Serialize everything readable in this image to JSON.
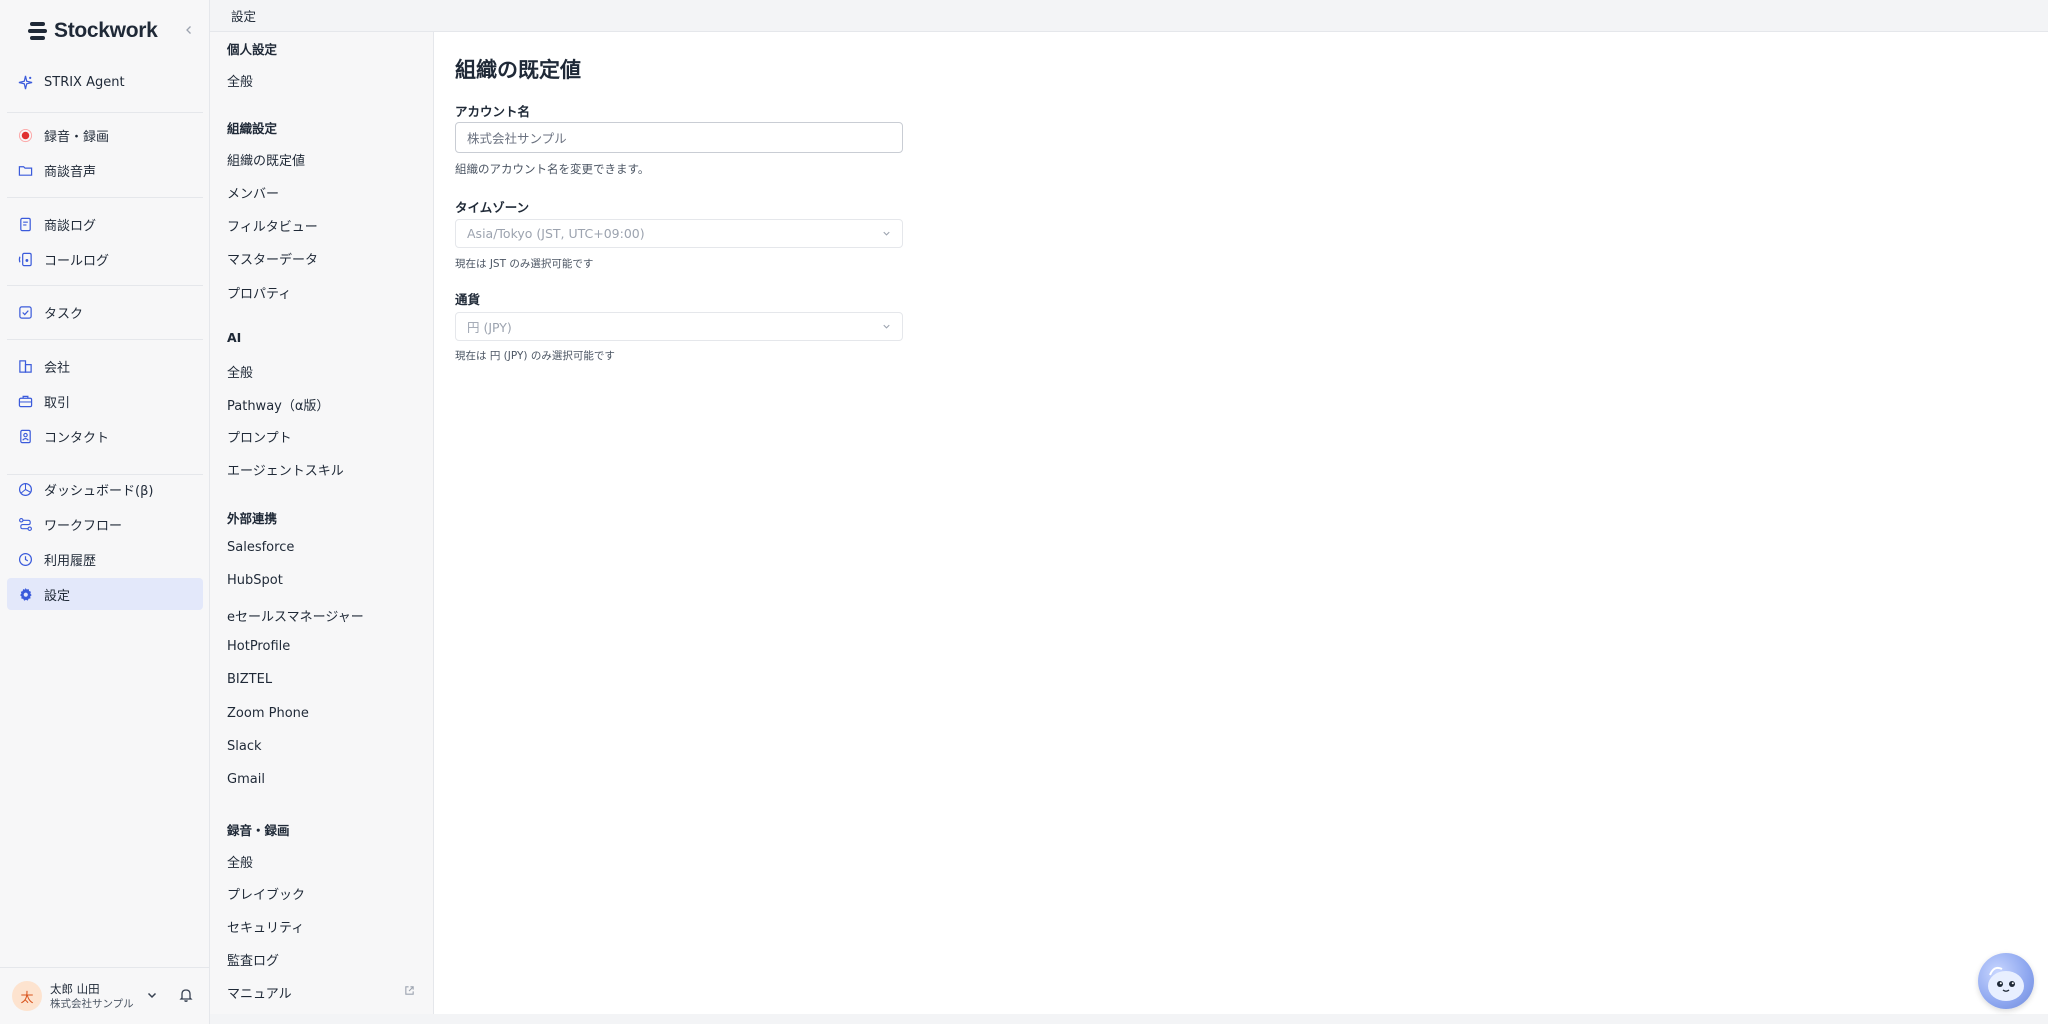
{
  "brand": {
    "name": "Stockwork"
  },
  "sidebar": {
    "items": [
      {
        "label": "STRIX Agent",
        "icon": "sparkle-icon"
      },
      {
        "label": "録音・録画",
        "icon": "record-icon"
      },
      {
        "label": "商談音声",
        "icon": "folder-icon"
      },
      {
        "label": "商談ログ",
        "icon": "document-icon"
      },
      {
        "label": "コールログ",
        "icon": "phone-log-icon"
      },
      {
        "label": "タスク",
        "icon": "task-check-icon"
      },
      {
        "label": "会社",
        "icon": "building-icon"
      },
      {
        "label": "取引",
        "icon": "briefcase-icon"
      },
      {
        "label": "コンタクト",
        "icon": "contact-card-icon"
      },
      {
        "label": "ダッシュボード(β)",
        "icon": "dashboard-icon"
      },
      {
        "label": "ワークフロー",
        "icon": "workflow-icon"
      },
      {
        "label": "利用履歴",
        "icon": "history-icon"
      },
      {
        "label": "設定",
        "icon": "gear-icon",
        "active": true
      }
    ]
  },
  "user": {
    "initial": "太",
    "name": "太郎 山田",
    "org": "株式会社サンプル"
  },
  "topbar": {
    "title": "設定"
  },
  "settings_nav": {
    "personal": {
      "heading": "個人設定",
      "items": [
        "全般"
      ]
    },
    "org": {
      "heading": "組織設定",
      "items": [
        "組織の既定値",
        "メンバー",
        "フィルタビュー",
        "マスターデータ",
        "プロパティ"
      ]
    },
    "ai": {
      "heading": "AI",
      "items": [
        "全般",
        "Pathway（α版）",
        "プロンプト",
        "エージェントスキル"
      ]
    },
    "integrations": {
      "heading": "外部連携",
      "items": [
        "Salesforce",
        "HubSpot",
        "eセールスマネージャー",
        "HotProfile",
        "BIZTEL",
        "Zoom Phone",
        "Slack",
        "Gmail"
      ]
    },
    "recording": {
      "heading": "録音・録画",
      "items": [
        "全般",
        "プレイブック",
        "セキュリティ",
        "監査ログ"
      ]
    },
    "manual": "マニュアル"
  },
  "main": {
    "title": "組織の既定値",
    "account": {
      "label": "アカウント名",
      "value": "株式会社サンプル",
      "help": "組織のアカウント名を変更できます。"
    },
    "timezone": {
      "label": "タイムゾーン",
      "value": "Asia/Tokyo (JST, UTC+09:00)",
      "help": "現在は JST のみ選択可能です"
    },
    "currency": {
      "label": "通貨",
      "value": "円 (JPY)",
      "help": "現在は 円 (JPY) のみ選択可能です"
    }
  },
  "colors": {
    "accent": "#3b5bdb",
    "record": "#e03131",
    "active_bg": "#e3e8fa"
  }
}
